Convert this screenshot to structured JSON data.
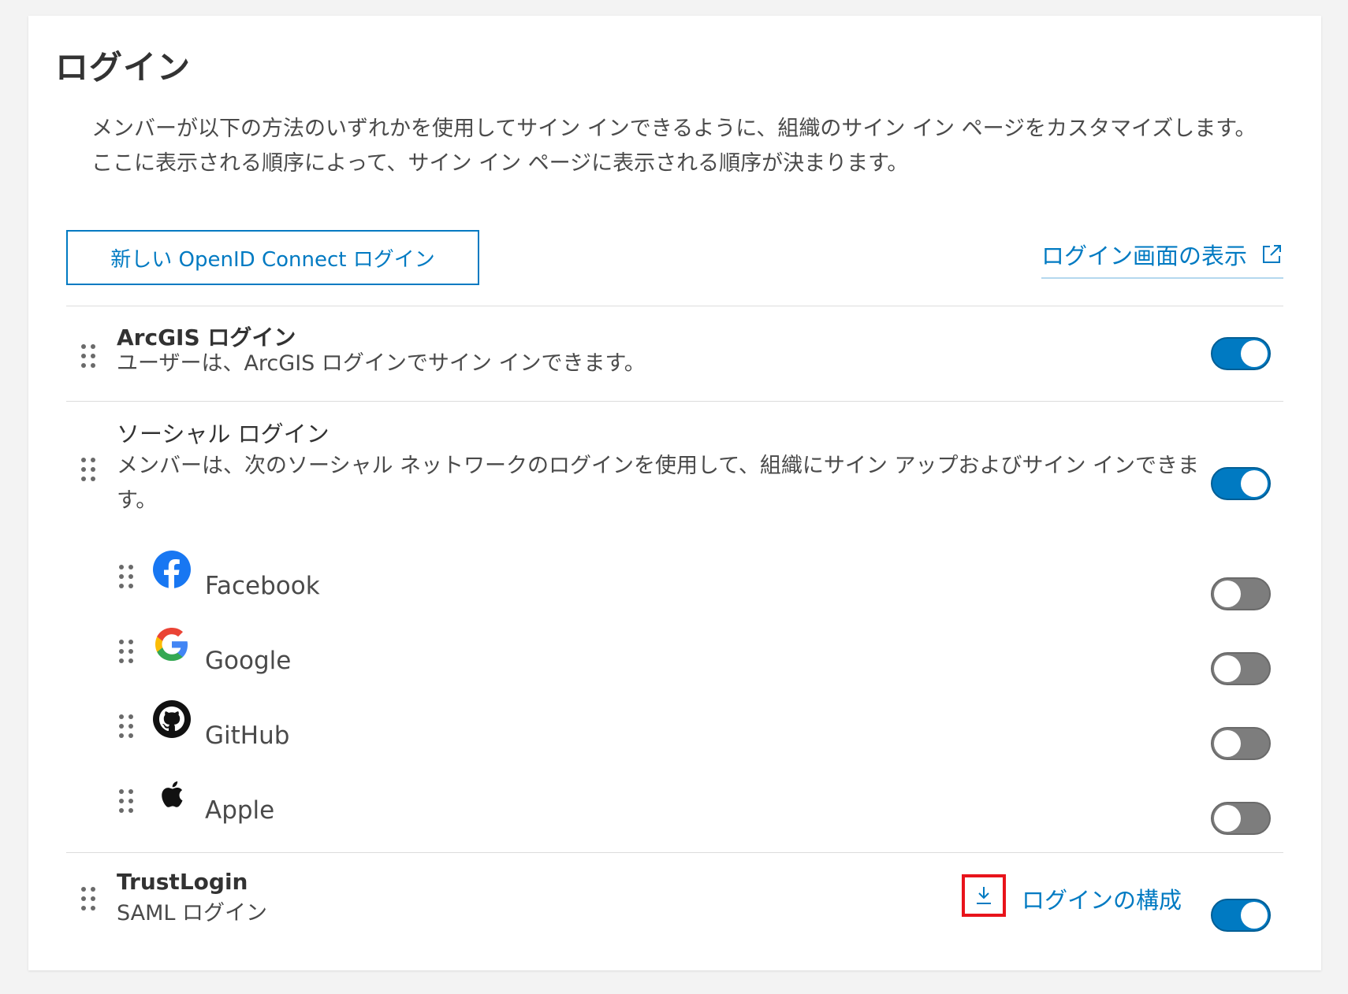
{
  "page": {
    "title": "ログイン",
    "description": "メンバーが以下の方法のいずれかを使用してサイン インできるように、組織のサイン イン ページをカスタマイズします。 ここに表示される順序によって、サイン イン ページに表示される順序が決まります。"
  },
  "actions": {
    "new_oidc_label": "新しい OpenID Connect ログイン",
    "view_login_label": "ログイン画面の表示"
  },
  "colors": {
    "accent": "#007ac2",
    "toggle_off": "#7d7d7d",
    "highlight_border": "#e8141b"
  },
  "logins": {
    "arcgis": {
      "title": "ArcGIS ログイン",
      "description": "ユーザーは、ArcGIS ログインでサイン インできます。",
      "enabled": true
    },
    "social": {
      "title": "ソーシャル ログイン",
      "description": "メンバーは、次のソーシャル ネットワークのログインを使用して、組織にサイン アップおよびサイン インできます。",
      "enabled": true,
      "providers": [
        {
          "name": "Facebook",
          "icon": "facebook-icon",
          "enabled": false
        },
        {
          "name": "Google",
          "icon": "google-icon",
          "enabled": false
        },
        {
          "name": "GitHub",
          "icon": "github-icon",
          "enabled": false
        },
        {
          "name": "Apple",
          "icon": "apple-icon",
          "enabled": false
        }
      ]
    },
    "trustlogin": {
      "title": "TrustLogin",
      "subtitle": "SAML ログイン",
      "configure_label": "ログインの構成",
      "download_icon": "download-icon",
      "enabled": true
    }
  }
}
